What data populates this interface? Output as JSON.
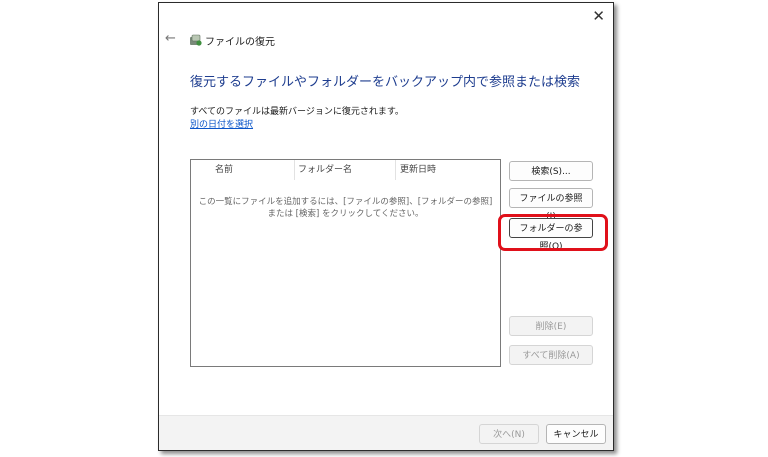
{
  "window": {
    "title": "ファイルの復元",
    "close_glyph": "✕",
    "back_glyph": "←",
    "icon": "restore-icon"
  },
  "main": {
    "heading": "復元するファイルやフォルダーをバックアップ内で参照または検索",
    "info": "すべてのファイルは最新バージョンに復元されます。",
    "link": "別の日付を選択"
  },
  "list": {
    "columns": [
      "名前",
      "フォルダー名",
      "更新日時"
    ],
    "empty_message": "この一覧にファイルを追加するには、[ファイルの参照]、[フォルダーの参照] または [検索] をクリックしてください。"
  },
  "buttons": {
    "search": "検索(S)...",
    "browse_files": "ファイルの参照(I)",
    "browse_folders": "フォルダーの参照(O)",
    "remove": "削除(E)",
    "remove_all": "すべて削除(A)"
  },
  "footer": {
    "next": "次へ(N)",
    "cancel": "キャンセル"
  },
  "colors": {
    "accent": "#1e3d8f",
    "link": "#0a55c9",
    "highlight": "#e0101a"
  }
}
